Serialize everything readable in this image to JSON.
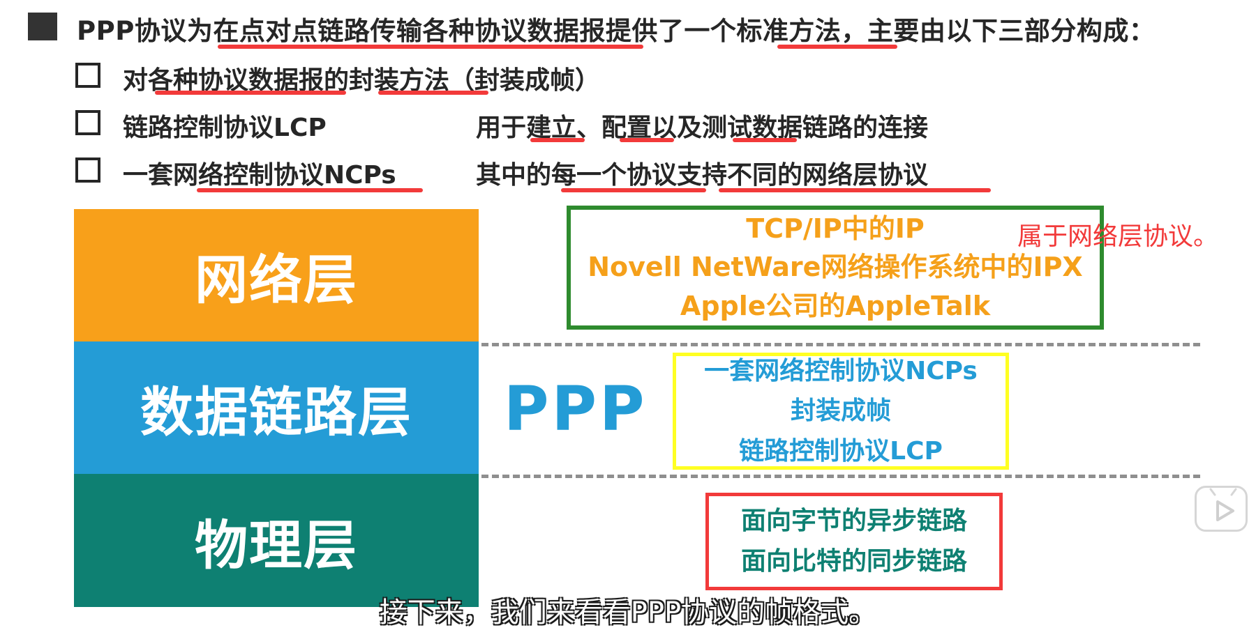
{
  "title": {
    "text": "PPP协议为在点对点链路传输各种协议数据报提供了一个标准方法，主要由以下三部分构成："
  },
  "bullets": [
    {
      "left": "对各种协议数据报的封装方法（封装成帧）",
      "right": ""
    },
    {
      "left": "链路控制协议LCP",
      "right": "用于建立、配置以及测试数据链路的连接"
    },
    {
      "left": "一套网络控制协议NCPs",
      "right": "其中的每一个协议支持不同的网络层协议"
    }
  ],
  "layers": {
    "network": "网络层",
    "datalink": "数据链路层",
    "physical": "物理层"
  },
  "ppp_label": "PPP",
  "network_box": [
    "TCP/IP中的IP",
    "Novell NetWare网络操作系统中的IPX",
    "Apple公司的AppleTalk"
  ],
  "network_note": "属于网络层协议。",
  "datalink_box": [
    "一套网络控制协议NCPs",
    "封装成帧",
    "链路控制协议LCP"
  ],
  "physical_box": [
    "面向字节的异步链路",
    "面向比特的同步链路"
  ],
  "subtitle": "接下来，我们来看看PPP协议的帧格式。",
  "colors": {
    "network": "#f8a01a",
    "datalink": "#249cd6",
    "physical": "#0e8072",
    "underline": "#f23a3a",
    "green_border": "#2e8b2e",
    "yellow_border": "#ffff22",
    "red_border": "#f23a3a"
  },
  "icons": [
    "square-bullet-icon",
    "checkbox-icon",
    "play-icon"
  ]
}
